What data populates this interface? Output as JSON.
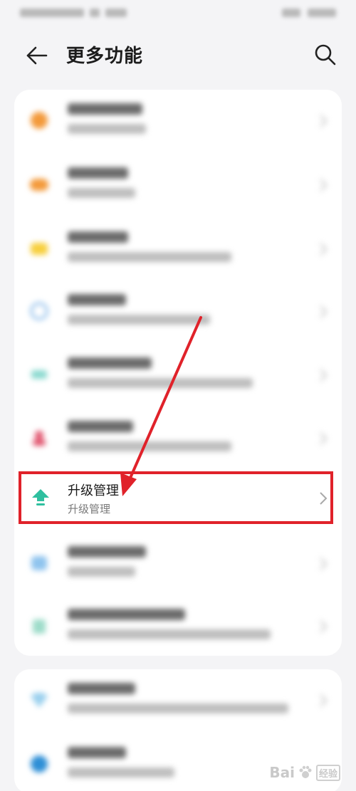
{
  "header": {
    "title": "更多功能"
  },
  "highlighted_item": {
    "title": "升级管理",
    "subtitle": "升级管理"
  },
  "watermark": {
    "brand_left": "Bai",
    "brand_right": "经验"
  },
  "colors": {
    "highlight": "#e0222a",
    "upgrade_icon": "#2fbf9f",
    "annotation_arrow": "#e0222a"
  },
  "icons": {
    "back": "back-arrow-icon",
    "search": "search-icon",
    "upgrade": "upload-arrow-icon",
    "chevron": "chevron-right-icon"
  }
}
